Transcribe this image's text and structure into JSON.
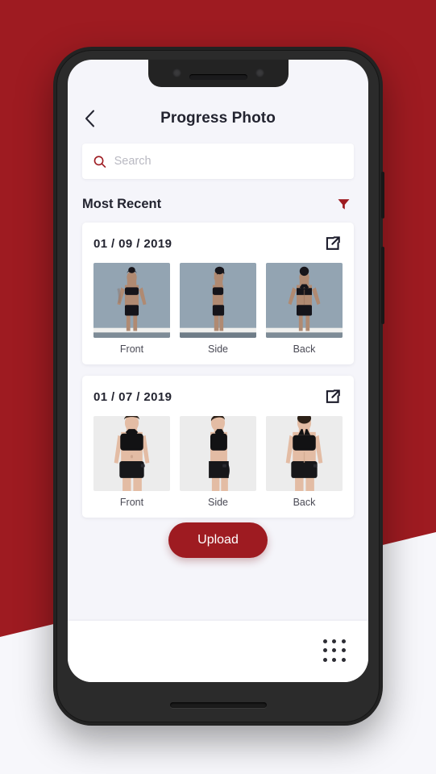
{
  "theme": {
    "brand_red": "#9E1B21",
    "page_bg": "#F5F5FA",
    "card_bg": "#FFFFFF",
    "text_dark": "#232430"
  },
  "header": {
    "title": "Progress Photo",
    "back_icon": "chevron-left-icon"
  },
  "search": {
    "placeholder": "Search",
    "value": "",
    "icon": "search-icon"
  },
  "section": {
    "title": "Most Recent",
    "filter_icon": "filter-funnel-icon"
  },
  "cards": [
    {
      "date": "01 / 09 / 2019",
      "share_icon": "share-icon",
      "photos": [
        {
          "label": "Front",
          "pose": "front",
          "bg": "#93a4b2"
        },
        {
          "label": "Side",
          "pose": "side",
          "bg": "#93a4b2"
        },
        {
          "label": "Back",
          "pose": "back",
          "bg": "#93a4b2"
        }
      ]
    },
    {
      "date": "01 / 07 / 2019",
      "share_icon": "share-icon",
      "photos": [
        {
          "label": "Front",
          "pose": "front",
          "bg": "#ececec"
        },
        {
          "label": "Side",
          "pose": "side",
          "bg": "#ececec"
        },
        {
          "label": "Back",
          "pose": "back",
          "bg": "#ececec"
        }
      ]
    }
  ],
  "upload": {
    "label": "Upload"
  },
  "bottom_bar": {
    "apps_icon": "grid-dots-icon"
  }
}
